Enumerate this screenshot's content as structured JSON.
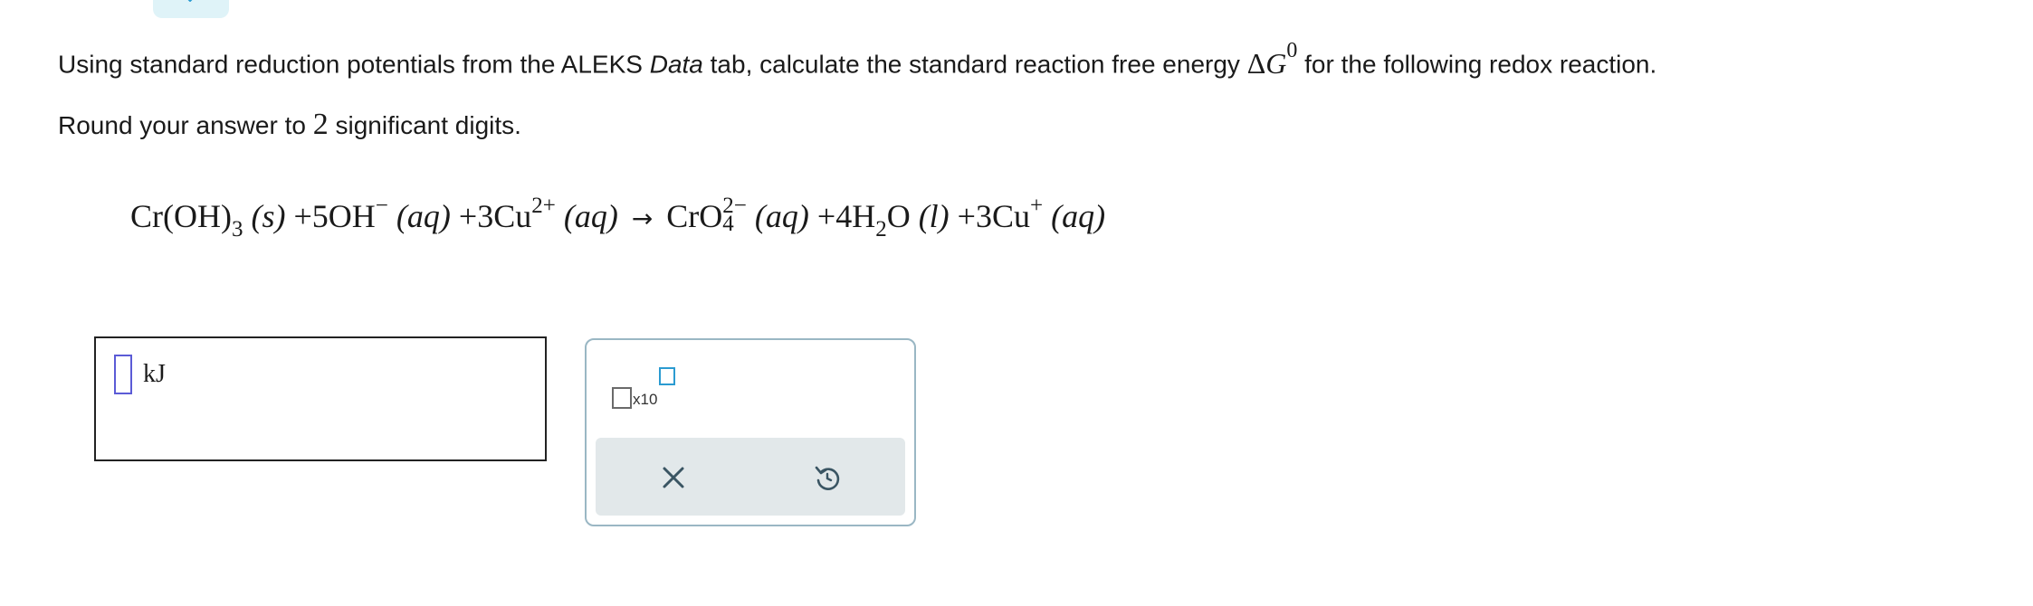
{
  "question": {
    "intro": "Using standard reduction potentials from the ALEKS ",
    "data_word": "Data",
    "middle": " tab, calculate the standard reaction free energy ",
    "delta": "Δ",
    "g_symbol": "G",
    "superscript": "0",
    "tail": " for the following redox reaction.",
    "round_prefix": "Round your answer to ",
    "round_digits": "2",
    "round_suffix": " significant digits."
  },
  "equation": {
    "r1_a": "Cr",
    "r1_b": "(OH)",
    "r1_sub": "3",
    "r1_state": "(s)",
    "plus1": "+",
    "r2_coef": "5",
    "r2": "OH",
    "r2_sup": "−",
    "r2_state": "(aq)",
    "plus2": "+",
    "r3_coef": "3",
    "r3": "Cu",
    "r3_sup": "2+",
    "r3_state": "(aq)",
    "arrow": "→",
    "p1": "CrO",
    "p1_sup": "2−",
    "p1_sub": "4",
    "p1_state": "(aq)",
    "plus3": "+",
    "p2_coef": "4",
    "p2_a": "H",
    "p2_sub": "2",
    "p2_b": "O",
    "p2_state": "(l)",
    "plus4": "+",
    "p3_coef": "3",
    "p3": "Cu",
    "p3_sup": "+",
    "p3_state": "(aq)"
  },
  "answer": {
    "value": "",
    "unit": "kJ"
  },
  "tools": {
    "x10_label": "x10",
    "clear_icon": "close-icon",
    "undo_icon": "undo-icon"
  },
  "colors": {
    "input_border": "#5b5bd6",
    "accent": "#2b9bd1",
    "panel_border": "#9ab7c4",
    "action_bar": "#e2e8ea",
    "tab_bg": "#dff3f8"
  }
}
